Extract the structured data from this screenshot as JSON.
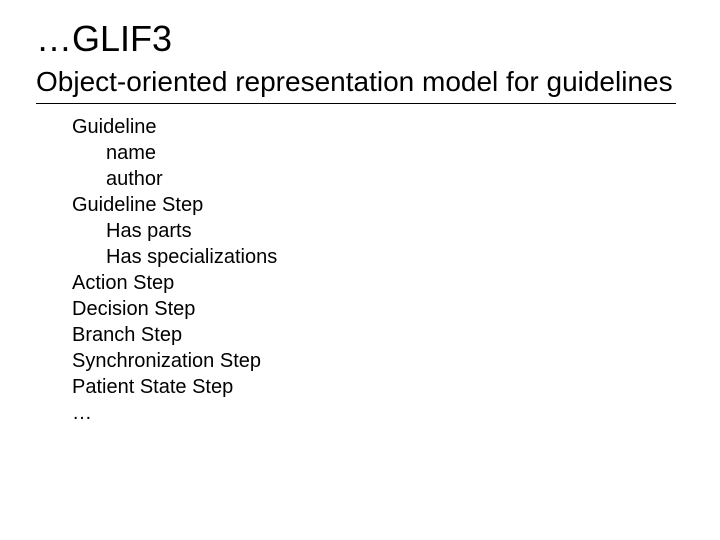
{
  "title": "…GLIF3",
  "subtitle": "Object-oriented representation model for guidelines",
  "outline": {
    "item1": "Guideline",
    "item1a": "name",
    "item1b": "author",
    "item2": "Guideline Step",
    "item2a": "Has parts",
    "item2b": "Has specializations",
    "item3": "Action Step",
    "item4": "Decision Step",
    "item5": "Branch Step",
    "item6": "Synchronization Step",
    "item7": "Patient State Step",
    "item8": "…"
  }
}
